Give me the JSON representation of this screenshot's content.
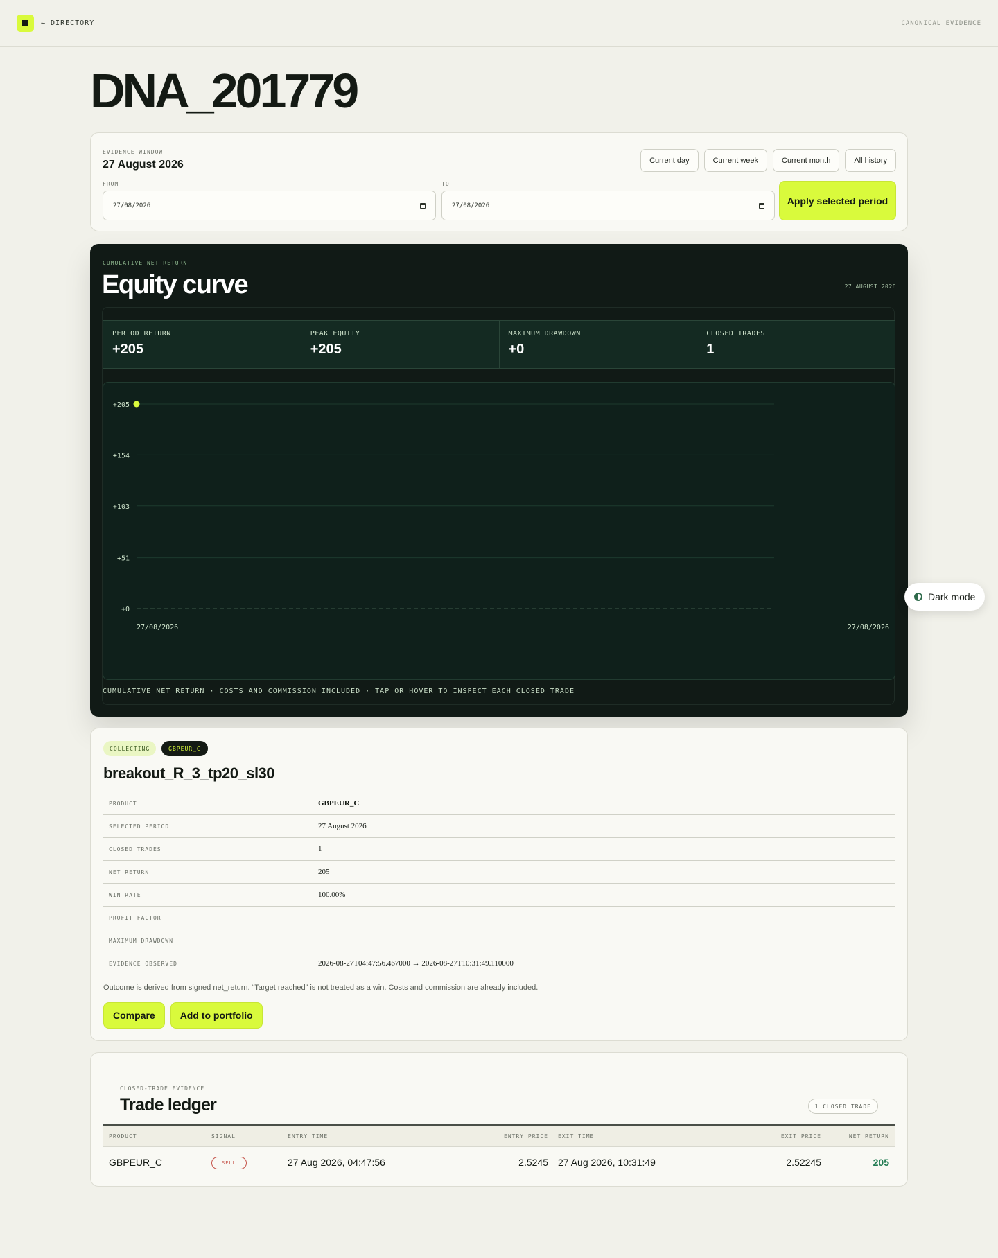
{
  "topbar": {
    "back_label": "← DIRECTORY",
    "right_label": "CANONICAL EVIDENCE"
  },
  "page_title": "DNA_201779",
  "evidence_window": {
    "label": "EVIDENCE WINDOW",
    "date": "27 August 2026",
    "quick_buttons": [
      "Current day",
      "Current week",
      "Current month",
      "All history"
    ],
    "from_label": "FROM",
    "from_value": "27/08/2026",
    "to_label": "TO",
    "to_value": "27/08/2026",
    "apply_label": "Apply selected period"
  },
  "equity": {
    "eyebrow": "CUMULATIVE NET RETURN",
    "title": "Equity curve",
    "date": "27 AUGUST 2026",
    "stats": [
      {
        "label": "PERIOD RETURN",
        "value": "+205"
      },
      {
        "label": "PEAK EQUITY",
        "value": "+205"
      },
      {
        "label": "MAXIMUM DRAWDOWN",
        "value": "+0"
      },
      {
        "label": "CLOSED TRADES",
        "value": "1"
      }
    ],
    "caption": "CUMULATIVE NET RETURN · COSTS AND COMMISSION INCLUDED · TAP OR HOVER TO INSPECT EACH CLOSED TRADE"
  },
  "chart_data": {
    "type": "line",
    "title": "Equity curve",
    "y_ticks": [
      "+205",
      "+154",
      "+103",
      "+51",
      "+0"
    ],
    "y_tick_values": [
      205,
      154,
      103,
      51,
      0
    ],
    "x_ticks": [
      "27/08/2026",
      "27/08/2026"
    ],
    "ylim": [
      0,
      205
    ],
    "series": [
      {
        "x": [
          "27/08/2026"
        ],
        "values": [
          205
        ]
      }
    ],
    "baseline": 0,
    "grid": true,
    "accent": "#d9fa3c"
  },
  "dark_mode_label": "Dark mode",
  "strategy": {
    "badges": [
      "COLLECTING",
      "GBPEUR_C"
    ],
    "name": "breakout_R_3_tp20_sl30",
    "rows": [
      {
        "key": "PRODUCT",
        "value": "GBPEUR_C"
      },
      {
        "key": "SELECTED PERIOD",
        "value": "27 August 2026"
      },
      {
        "key": "CLOSED TRADES",
        "value": "1"
      },
      {
        "key": "NET RETURN",
        "value": "205"
      },
      {
        "key": "WIN RATE",
        "value": "100.00%"
      },
      {
        "key": "PROFIT FACTOR",
        "value": "—"
      },
      {
        "key": "MAXIMUM DRAWDOWN",
        "value": "—"
      },
      {
        "key": "EVIDENCE OBSERVED",
        "value": "2026-08-27T04:47:56.467000 → 2026-08-27T10:31:49.110000"
      }
    ],
    "note": "Outcome is derived from signed net_return. “Target reached” is not treated as a win. Costs and commission are already included.",
    "compare_label": "Compare",
    "portfolio_label": "Add to portfolio"
  },
  "ledger": {
    "eyebrow": "CLOSED-TRADE EVIDENCE",
    "title": "Trade ledger",
    "count": "1 CLOSED TRADE",
    "headers": [
      "PRODUCT",
      "SIGNAL",
      "ENTRY TIME",
      "ENTRY PRICE",
      "EXIT TIME",
      "EXIT PRICE",
      "NET RETURN"
    ],
    "rows": [
      {
        "product": "GBPEUR_C",
        "signal": "SELL",
        "entry_time": "27 Aug 2026, 04:47:56",
        "entry_price": "2.5245",
        "exit_time": "27 Aug 2026, 10:31:49",
        "exit_price": "2.52245",
        "net_return": "205"
      }
    ]
  }
}
